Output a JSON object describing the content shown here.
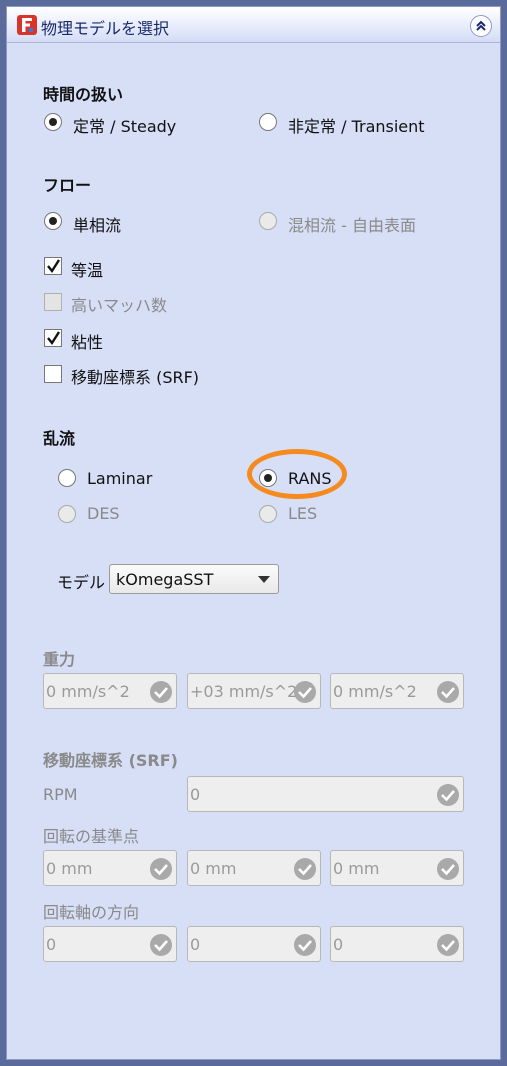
{
  "window": {
    "title": "物理モデルを選択"
  },
  "time": {
    "heading": "時間の扱い",
    "steady": "定常 / Steady",
    "transient": "非定常 / Transient"
  },
  "flow": {
    "heading": "フロー",
    "single_phase": "単相流",
    "multiphase": "混相流 - 自由表面",
    "isothermal": "等温",
    "high_mach": "高いマッハ数",
    "viscous": "粘性",
    "srf": "移動座標系 (SRF)"
  },
  "turbulence": {
    "heading": "乱流",
    "laminar": "Laminar",
    "rans": "RANS",
    "des": "DES",
    "les": "LES",
    "model_label": "モデル",
    "model_value": "kOmegaSST"
  },
  "gravity": {
    "heading": "重力",
    "x": "0 mm/s^2",
    "y": "+03 mm/s^2",
    "z": "0 mm/s^2"
  },
  "srf_section": {
    "heading": "移動座標系 (SRF)",
    "rpm_label": "RPM",
    "rpm_value": "0",
    "center_label": "回転の基準点",
    "center_x": "0 mm",
    "center_y": "0 mm",
    "center_z": "0 mm",
    "axis_label": "回転軸の方向",
    "axis_x": "0",
    "axis_y": "0",
    "axis_z": "0"
  },
  "colors": {
    "highlight": "#f58a1f",
    "panel": "#d7dff7"
  }
}
